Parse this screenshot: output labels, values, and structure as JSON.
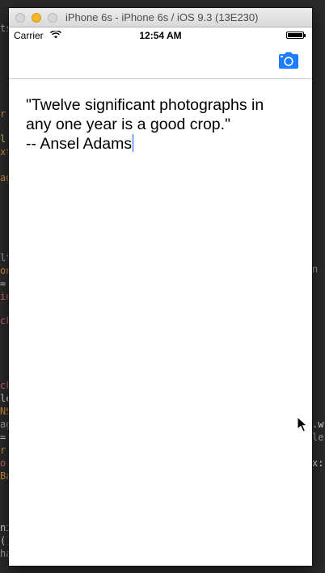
{
  "window": {
    "title": "iPhone 6s - iPhone 6s / iOS 9.3 (13E230)"
  },
  "status_bar": {
    "carrier": "Carrier",
    "time": "12:54 AM"
  },
  "navbar": {
    "camera_icon": "camera-icon"
  },
  "text_view": {
    "lines": [
      "\"Twelve significant photographs in",
      "any one year is a good crop.\"",
      "-- Ansel Adams"
    ]
  },
  "background_code": {
    "left": [
      "ts",
      "r",
      "l",
      "xt",
      "ag",
      "lt",
      "on",
      "=",
      "in",
      "ck",
      "ck",
      "le",
      "NS",
      "ag",
      "=",
      "r:",
      "o",
      "Ba",
      "ni",
      "()",
      "ha"
    ],
    "right": [
      "n",
      ".w",
      "le",
      "x:"
    ]
  },
  "colors": {
    "accent": "#1e7cff",
    "caret": "#1e5bff"
  }
}
